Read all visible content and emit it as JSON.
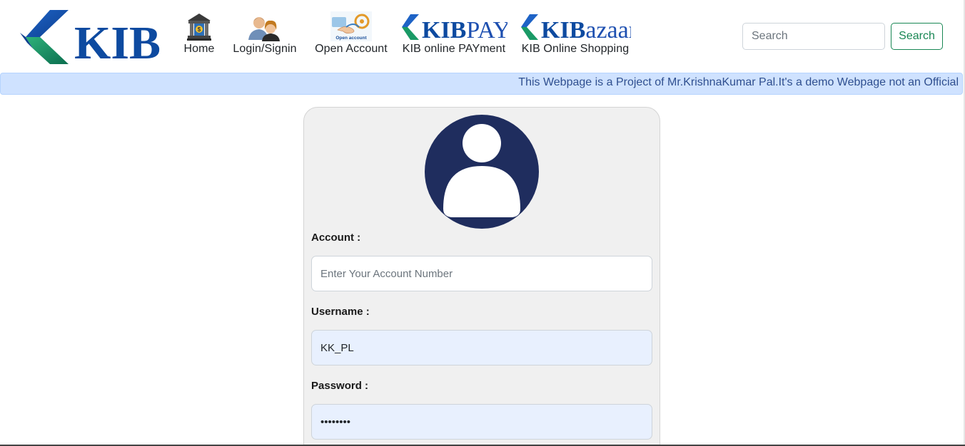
{
  "brand": {
    "name": "KIB"
  },
  "nav": {
    "home": {
      "label": "Home",
      "icon": "bank-icon"
    },
    "login": {
      "label": "Login/Signin",
      "icon": "users-icon"
    },
    "open_account": {
      "label": "Open Account",
      "icon": "open-account-icon",
      "icon_caption": "Open account"
    },
    "kibpay": {
      "label": "KIB online PAYment",
      "logo_prefix": "KIB",
      "logo_suffix": "PAY"
    },
    "kibazaar": {
      "label": "KIB Online Shopping",
      "logo_prefix": "KIB",
      "logo_suffix": "azaar"
    }
  },
  "search": {
    "placeholder": "Search",
    "button_label": "Search"
  },
  "banner": {
    "text": "This Webpage is a Project of Mr.KrishnaKumar Pal.It's a demo Webpage not an Official"
  },
  "login_form": {
    "account_label": "Account :",
    "account_placeholder": "Enter Your Account Number",
    "account_value": "",
    "username_label": "Username :",
    "username_value": "KK_PL",
    "password_label": "Password :",
    "password_value": "password"
  },
  "colors": {
    "brand_blue": "#0d4aa0",
    "brand_green": "#1a8a5a",
    "avatar_bg": "#1f2d5e",
    "banner_bg": "#cfe2ff",
    "search_button": "#198754"
  }
}
